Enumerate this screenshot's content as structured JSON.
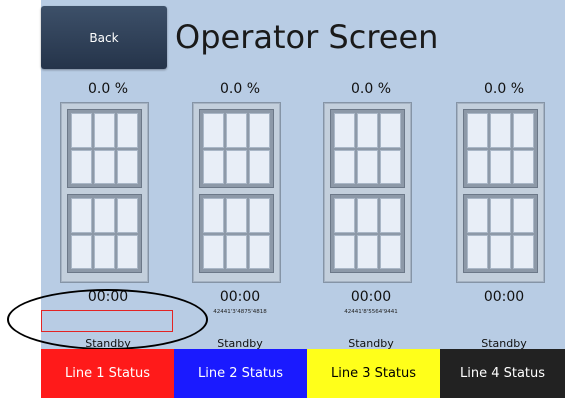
{
  "header": {
    "back_label": "Back",
    "title": "Operator Screen"
  },
  "lines": [
    {
      "percent": "0.0 %",
      "time": "00:00",
      "serial": "",
      "state": "Standby",
      "status_label": "Line 1 Status",
      "status_color": "#ff1a1a",
      "text_color": "#ffffff"
    },
    {
      "percent": "0.0 %",
      "time": "00:00",
      "serial": "42441'3'4875'4818",
      "state": "Standby",
      "status_label": "Line 2 Status",
      "status_color": "#1a1aff",
      "text_color": "#ffffff"
    },
    {
      "percent": "0.0 %",
      "time": "00:00",
      "serial": "42441'8'5564'9441",
      "state": "Standby",
      "status_label": "Line 3 Status",
      "status_color": "#ffff1a",
      "text_color": "#000000"
    },
    {
      "percent": "0.0 %",
      "time": "00:00",
      "serial": "",
      "state": "Standby",
      "status_label": "Line 4 Status",
      "status_color": "#222222",
      "text_color": "#ffffff"
    }
  ],
  "icons": {
    "window": "window-icon"
  },
  "colors": {
    "panel_background": "#b8cce4",
    "highlight_box": "#e32424"
  }
}
